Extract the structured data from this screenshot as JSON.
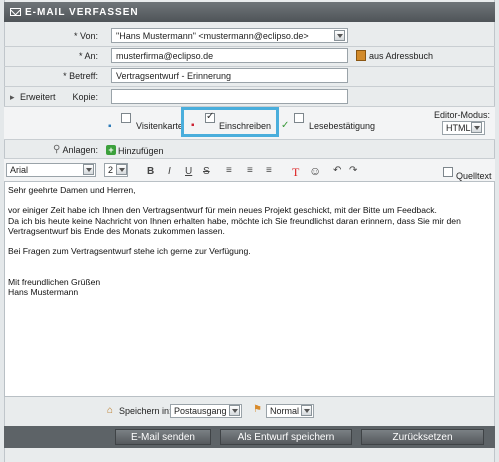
{
  "window": {
    "title": "E-MAIL VERFASSEN"
  },
  "header": {
    "from_label": "* Von:",
    "from_value": "\"Hans Mustermann\" <mustermann@eclipso.de>",
    "to_label": "* An:",
    "to_value": "musterfirma@eclipso.de",
    "addressbook_label": "aus Adressbuch",
    "subject_label": "* Betreff:",
    "subject_value": "Vertragsentwurf - Erinnerung",
    "expand_label": "Erweitert",
    "cc_label": "Kopie:",
    "cc_value": ""
  },
  "options": {
    "business_card_label": "Visitenkarte",
    "registered_label": "Einschreiben",
    "read_receipt_label": "Lesebestätigung",
    "editor_mode_label": "Editor-Modus:",
    "editor_mode_value": "HTML",
    "business_card_checked": false,
    "registered_checked": true,
    "read_receipt_checked": false
  },
  "attachments": {
    "label": "Anlagen:",
    "add_label": "Hinzufügen"
  },
  "toolbar": {
    "font_value": "Arial",
    "size_value": "2",
    "bold": "B",
    "italic": "I",
    "underline": "U",
    "strike": "S",
    "text_color": "T",
    "smiley": "☺",
    "undo": "↶",
    "redo": "↷",
    "source_label": "Quelltext"
  },
  "body": {
    "lines": [
      "Sehr geehrte Damen und Herren,",
      "",
      "vor einiger Zeit habe ich Ihnen den Vertragsentwurf für mein neues Projekt geschickt, mit der Bitte um Feedback.",
      "Da ich bis heute keine Nachricht von Ihnen erhalten habe, möchte ich Sie freundlichst daran erinnern, dass Sie mir den",
      "Vertragsentwurf bis Ende des Monats zukommen lassen.",
      "",
      "Bei Fragen zum Vertragsentwurf stehe ich gerne zur Verfügung.",
      "",
      "",
      "Mit freundlichen Grüßen",
      "Hans Mustermann"
    ]
  },
  "footer": {
    "save_in_label": "Speichern in:",
    "save_in_value": "Postausgang",
    "priority_value": "Normal"
  },
  "actions": {
    "send_label": "E-Mail senden",
    "draft_label": "Als Entwurf speichern",
    "reset_label": "Zurücksetzen"
  },
  "colors": {
    "highlight": "#4aaedc",
    "titlebar": "#5a6064",
    "button_dark": "#5d6367"
  }
}
